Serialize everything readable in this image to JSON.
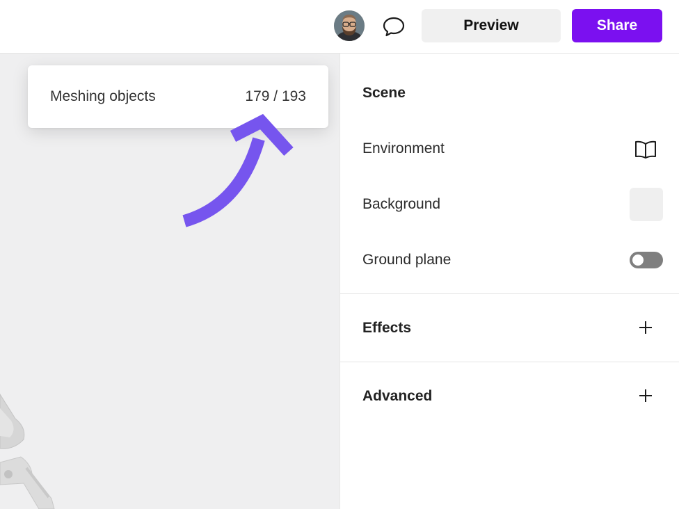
{
  "header": {
    "preview_label": "Preview",
    "share_label": "Share",
    "accent_color": "#7b10f0"
  },
  "progress": {
    "label": "Meshing objects",
    "count": "179 / 193",
    "current": 179,
    "total": 193
  },
  "panel": {
    "scene_title": "Scene",
    "environment_label": "Environment",
    "background_label": "Background",
    "background_color": "#efefef",
    "ground_plane_label": "Ground plane",
    "ground_plane_enabled": false,
    "effects_title": "Effects",
    "advanced_title": "Advanced"
  },
  "icons": {
    "comment": "speech-bubble",
    "environment": "open-book",
    "add": "plus"
  },
  "annotation_arrow_color": "#7655ee"
}
